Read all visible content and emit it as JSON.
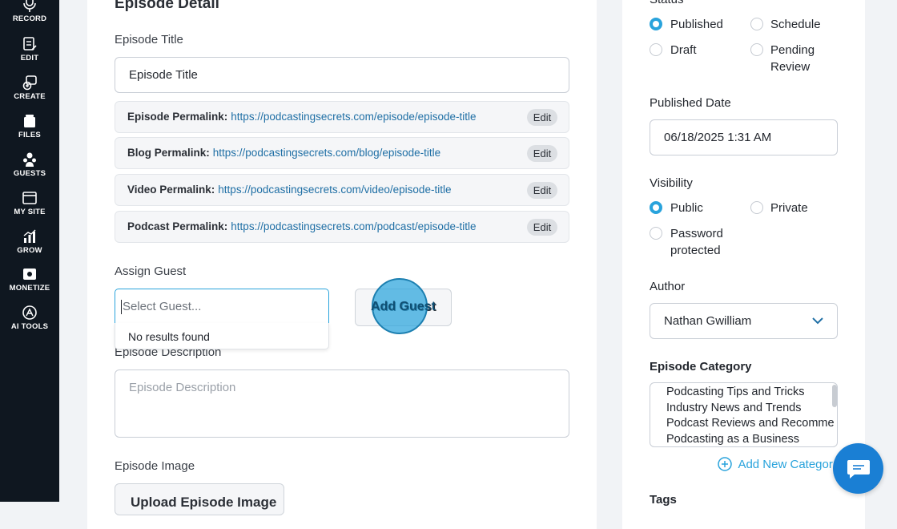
{
  "sidebar": {
    "items": [
      {
        "label": "RECORD",
        "icon": "microphone-icon"
      },
      {
        "label": "EDIT",
        "icon": "edit-document-icon"
      },
      {
        "label": "CREATE",
        "icon": "create-icon"
      },
      {
        "label": "FILES",
        "icon": "files-icon"
      },
      {
        "label": "GUESTS",
        "icon": "guests-icon"
      },
      {
        "label": "MY SITE",
        "icon": "site-icon"
      },
      {
        "label": "GROW",
        "icon": "chart-icon"
      },
      {
        "label": "MONETIZE",
        "icon": "money-icon"
      },
      {
        "label": "AI TOOLS",
        "icon": "ai-tools-icon"
      }
    ]
  },
  "main": {
    "heading": "Episode Detail",
    "episode_title_label": "Episode Title",
    "episode_title_value": "Episode Title",
    "permalinks": [
      {
        "label": "Episode Permalink:",
        "url": "https://podcastingsecrets.com/episode/episode-title",
        "edit": "Edit"
      },
      {
        "label": "Blog Permalink:",
        "url": "https://podcastingsecrets.com/blog/episode-title",
        "edit": "Edit"
      },
      {
        "label": "Video Permalink:",
        "url": "https://podcastingsecrets.com/video/episode-title",
        "edit": "Edit"
      },
      {
        "label": "Podcast Permalink:",
        "url": "https://podcastingsecrets.com/podcast/episode-title",
        "edit": "Edit"
      }
    ],
    "assign_guest_label": "Assign Guest",
    "guest_placeholder": "Select Guest...",
    "no_results": "No results found",
    "add_guest_button": "Add Guest",
    "description_label": "Episode Description",
    "description_placeholder": "Episode Description",
    "image_label": "Episode Image",
    "upload_button": "Upload Episode Image"
  },
  "right": {
    "status_label": "Status",
    "status_options": [
      {
        "label": "Published",
        "selected": true
      },
      {
        "label": "Schedule",
        "selected": false
      },
      {
        "label": "Draft",
        "selected": false
      },
      {
        "label_line1": "Pending",
        "label_line2": "Review",
        "selected": false
      }
    ],
    "published_date_label": "Published Date",
    "published_date_value": "06/18/2025 1:31 AM",
    "visibility_label": "Visibility",
    "visibility_options": [
      {
        "label": "Public",
        "selected": true
      },
      {
        "label": "Private",
        "selected": false
      },
      {
        "label_line1": "Password",
        "label_line2": "protected",
        "selected": false
      }
    ],
    "author_label": "Author",
    "author_value": "Nathan Gwilliam",
    "category_label": "Episode Category",
    "categories": [
      "Podcasting Tips and Tricks",
      "Industry News and Trends",
      "Podcast Reviews and Recomme",
      "Podcasting as a Business"
    ],
    "add_category": "Add New Categor",
    "tags_label": "Tags"
  },
  "colors": {
    "sidebar_bg": "#0f1720",
    "accent": "#29a3dc",
    "link": "#1f6fa5",
    "chat_button": "#1a7fd4"
  }
}
